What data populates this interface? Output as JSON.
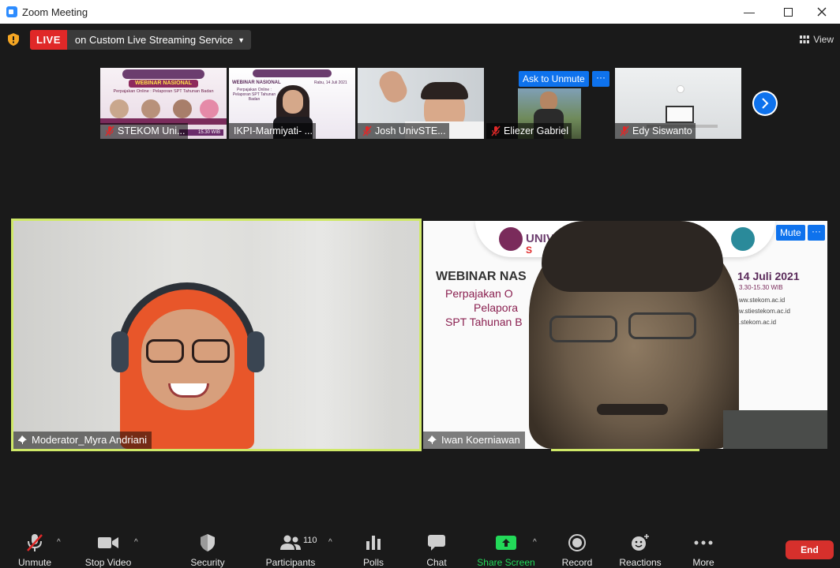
{
  "window": {
    "title": "Zoom Meeting"
  },
  "topbar": {
    "live_label": "LIVE",
    "stream_label": "on Custom Live Streaming Service",
    "view_label": "View"
  },
  "thumbnails": [
    {
      "name": "STEKOM Uni...",
      "muted": true,
      "banner_title": "WEBINAR NASIONAL",
      "banner_sub": "Perpajakan Online : Pelaporan SPT Tahunan Badan",
      "banner_time": "15.30 WIB"
    },
    {
      "name": "IKPI-Marmiyati- ...",
      "muted": false,
      "banner_title": "WEBINAR NASIONAL",
      "banner_sub": "Perpajakan Online : Pelaporan SPT Tahunan Badan",
      "banner_date": "Rabu, 14 Juli 2021"
    },
    {
      "name": "Josh UnivSTE...",
      "muted": true
    },
    {
      "name": "Eliezer Gabriel",
      "muted": true,
      "action": "Ask to Unmute",
      "more": "···"
    },
    {
      "name": "Edy Siswanto",
      "muted": true
    }
  ],
  "main_tiles": {
    "left": {
      "name": "Moderator_Myra Andriani"
    },
    "right": {
      "name": "Iwan Koerniawan",
      "action": "Mute",
      "more": "···",
      "bg_title": "WEBINAR NAS",
      "bg_date": "14 Juli 2021",
      "bg_time": "3.30-15.30 WIB",
      "bg_line1": "Perpajakan O",
      "bg_line2": "Pelapora",
      "bg_line3": "SPT Tahunan B",
      "bg_url1": "ww.stekom.ac.id",
      "bg_url2": "w.stiestekom.ac.id",
      "bg_url3": ".stekom.ac.id",
      "bg_logo_text": "UNIV",
      "bg_logo_text2": "S"
    }
  },
  "toolbar": {
    "unmute": "Unmute",
    "stop_video": "Stop Video",
    "security": "Security",
    "participants": "Participants",
    "participants_count": "110",
    "polls": "Polls",
    "chat": "Chat",
    "share_screen": "Share Screen",
    "record": "Record",
    "reactions": "Reactions",
    "more": "More",
    "end": "End"
  },
  "colors": {
    "accent_blue": "#0e72ed",
    "live_red": "#e02828",
    "end_red": "#d6302c",
    "share_green": "#23d959",
    "active_speaker": "#cfe868"
  }
}
